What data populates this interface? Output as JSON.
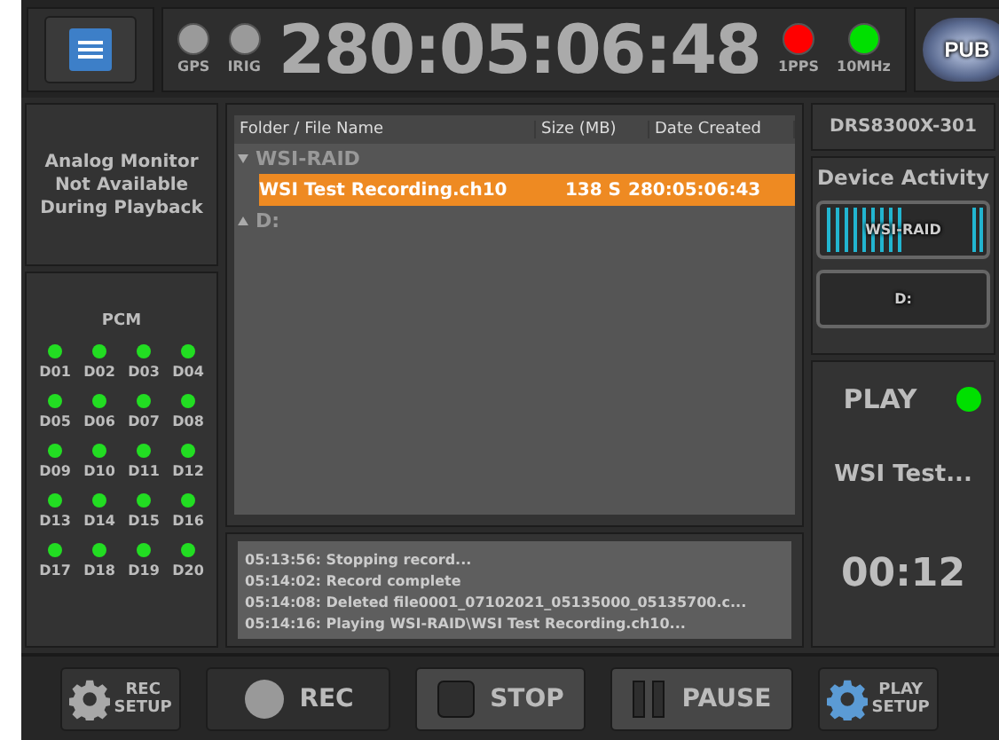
{
  "top_bar": {
    "left_indicators": [
      {
        "label": "GPS",
        "color": "#9a9a9a"
      },
      {
        "label": "IRIG",
        "color": "#9a9a9a"
      }
    ],
    "clock": "280:05:06:48",
    "right_indicators": [
      {
        "label": "1PPS",
        "color": "#ff0000"
      },
      {
        "label": "10MHz",
        "color": "#00e000"
      }
    ],
    "pub_button": "PUB"
  },
  "analog_monitor": "Analog Monitor Not Available During Playback",
  "pcm": {
    "title": "PCM",
    "channels": [
      {
        "label": "D01",
        "color": "#22dd22"
      },
      {
        "label": "D02",
        "color": "#22dd22"
      },
      {
        "label": "D03",
        "color": "#22dd22"
      },
      {
        "label": "D04",
        "color": "#22dd22"
      },
      {
        "label": "D05",
        "color": "#22dd22"
      },
      {
        "label": "D06",
        "color": "#22dd22"
      },
      {
        "label": "D07",
        "color": "#22dd22"
      },
      {
        "label": "D08",
        "color": "#22dd22"
      },
      {
        "label": "D09",
        "color": "#22dd22"
      },
      {
        "label": "D10",
        "color": "#22dd22"
      },
      {
        "label": "D11",
        "color": "#22dd22"
      },
      {
        "label": "D12",
        "color": "#22dd22"
      },
      {
        "label": "D13",
        "color": "#22dd22"
      },
      {
        "label": "D14",
        "color": "#22dd22"
      },
      {
        "label": "D15",
        "color": "#22dd22"
      },
      {
        "label": "D16",
        "color": "#22dd22"
      },
      {
        "label": "D17",
        "color": "#22dd22"
      },
      {
        "label": "D18",
        "color": "#22dd22"
      },
      {
        "label": "D19",
        "color": "#22dd22"
      },
      {
        "label": "D20",
        "color": "#22dd22"
      }
    ]
  },
  "file_table": {
    "columns": [
      "Folder / File Name",
      "Size (MB)",
      "Date Created"
    ],
    "folders": [
      {
        "name": "WSI-RAID",
        "expanded": true,
        "children": [
          {
            "name": "WSI Test Recording.ch10",
            "size": "138 S",
            "date": "280:05:06:43",
            "selected": true
          }
        ]
      },
      {
        "name": "D:",
        "expanded": false
      }
    ]
  },
  "log": [
    "05:13:56: Stopping record...",
    "05:14:02: Record complete",
    "05:14:08: Deleted file0001_07102021_05135000_05135700.c...",
    "05:14:16: Playing WSI-RAID\\WSI Test Recording.ch10..."
  ],
  "device_name": "DRS8300X-301",
  "device_activity": {
    "title": "Device Activity",
    "devices": [
      {
        "label": "WSI-RAID",
        "active": true
      },
      {
        "label": "D:",
        "active": false
      }
    ]
  },
  "playback": {
    "status": "PLAY",
    "color": "#00e000",
    "file": "WSI Test...",
    "elapsed": "00:12"
  },
  "buttons": [
    {
      "kind": "setup",
      "label": "REC SETUP",
      "accent": false
    },
    {
      "kind": "rec",
      "label": "REC"
    },
    {
      "kind": "stop",
      "label": "STOP"
    },
    {
      "kind": "pause",
      "label": "PAUSE"
    },
    {
      "kind": "setup",
      "label": "PLAY SETUP",
      "accent": true
    }
  ]
}
